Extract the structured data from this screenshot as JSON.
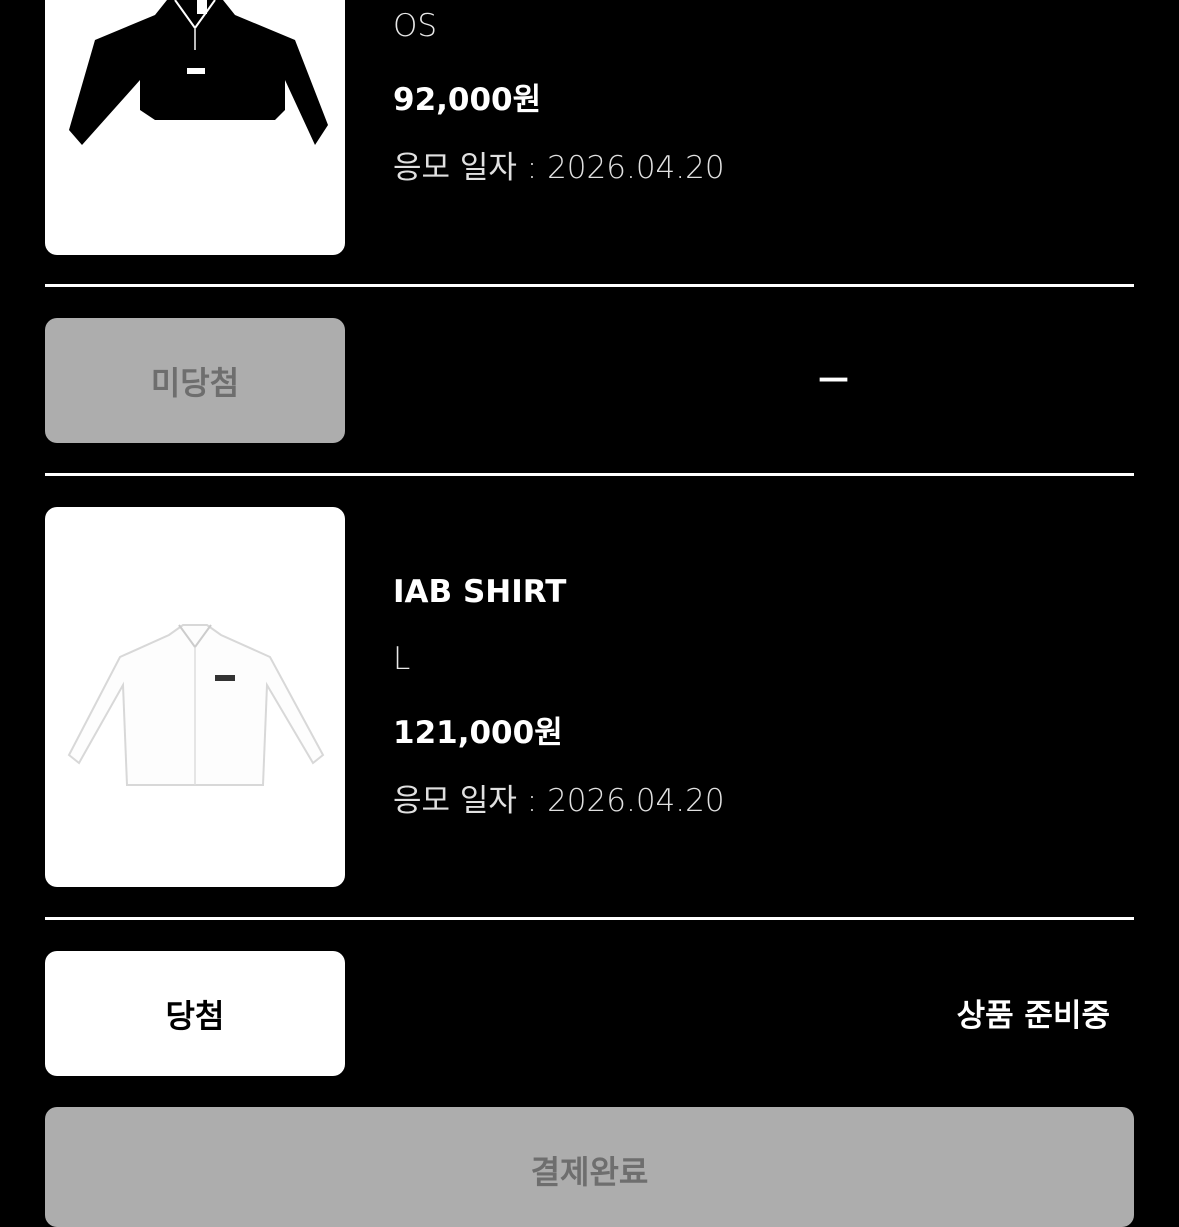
{
  "items": [
    {
      "name": "",
      "option": "OS",
      "price": "92,000원",
      "apply_date": "응모 일자 : 2026.04.20",
      "status_label": "미당첨",
      "status_text": "—"
    },
    {
      "name": "IAB SHIRT",
      "option": "L",
      "price": "121,000원",
      "apply_date": "응모 일자 : 2026.04.20",
      "status_label": "당첨",
      "status_text": "상품 준비중"
    }
  ],
  "payment": {
    "label": "결제완료"
  },
  "colors": {
    "background": "#000000",
    "disabled_button": "#adadad",
    "disabled_text": "#6e6e6e"
  }
}
